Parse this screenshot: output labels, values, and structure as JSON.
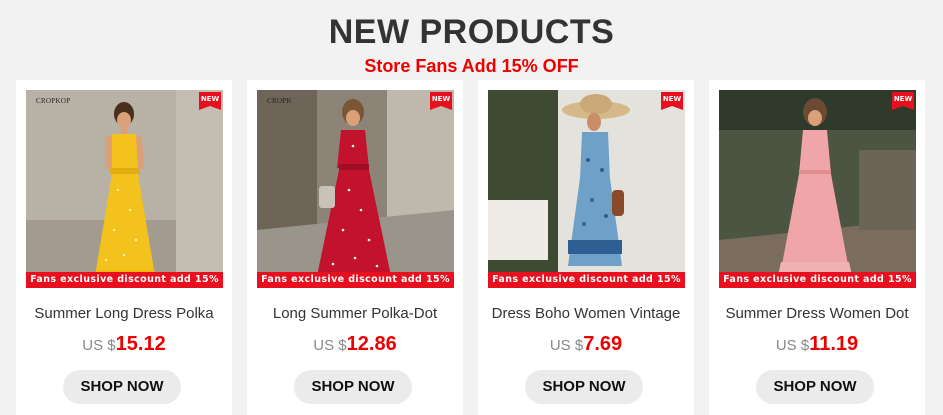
{
  "header": {
    "title": "NEW PRODUCTS",
    "subtitle": "Store Fans Add 15% OFF"
  },
  "theme": {
    "accent": "#e8101f",
    "title_color": "#333333",
    "page_bg": "#f2f2f2",
    "button_bg": "#ebebeb"
  },
  "products": [
    {
      "name": "Summer Long Dress Polka",
      "currency": "US $",
      "price": "15.12",
      "button": "SHOP NOW",
      "badge": "NEW",
      "brand": "CROPKOP",
      "promo": "Fans exclusive discount add 15%",
      "dress_color": "#f4c21c"
    },
    {
      "name": "Long Summer Polka-Dot",
      "currency": "US $",
      "price": "12.86",
      "button": "SHOP NOW",
      "badge": "NEW",
      "brand": "CROPK",
      "promo": "Fans exclusive discount add 15%",
      "dress_color": "#c3122e"
    },
    {
      "name": "Dress Boho Women Vintage",
      "currency": "US $",
      "price": "7.69",
      "button": "SHOP NOW",
      "badge": "NEW",
      "promo": "Fans exclusive discount add 15%",
      "dress_color": "#6fa0c8"
    },
    {
      "name": "Summer Dress Women Dot",
      "currency": "US $",
      "price": "11.19",
      "button": "SHOP NOW",
      "badge": "NEW",
      "promo": "Fans exclusive discount add 15%",
      "dress_color": "#f0a5a8"
    }
  ]
}
